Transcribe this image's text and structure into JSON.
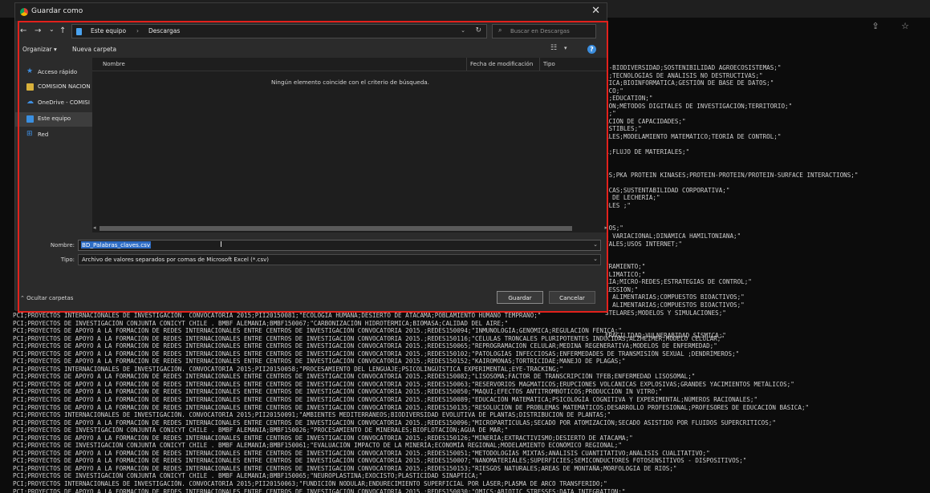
{
  "dialog": {
    "title": "Guardar como",
    "close_glyph": "✕",
    "nav": {
      "back": "←",
      "forward": "→",
      "recent": "⌄",
      "up": "↑",
      "breadcrumb": [
        "Este equipo",
        "Descargas"
      ],
      "separator": "›",
      "dropdown": "⌄",
      "refresh": "↻"
    },
    "search": {
      "placeholder": "Buscar en Descargas",
      "icon": "⌕"
    },
    "toolbar": {
      "organize": "Organizar ▾",
      "new_folder": "Nueva carpeta",
      "view_icon": "☷",
      "view_dropdown": "▾",
      "help": "?"
    },
    "sidebar": {
      "items": [
        {
          "label": "Acceso rápido",
          "icon": "star-icon"
        },
        {
          "label": "COMISION NACION",
          "icon": "folder-icon"
        },
        {
          "label": "OneDrive - COMISI",
          "icon": "cloud-icon"
        },
        {
          "label": "Este equipo",
          "icon": "computer-icon",
          "selected": true
        },
        {
          "label": "Red",
          "icon": "network-icon"
        }
      ]
    },
    "file_pane": {
      "columns": [
        "Nombre",
        "Fecha de modificación",
        "Tipo"
      ],
      "empty_message": "Ningún elemento coincide con el criterio de búsqueda.",
      "scroll_left": "◂",
      "scroll_right": "▸"
    },
    "form": {
      "name_label": "Nombre:",
      "name_value": "BD_Palabras_claves.csv",
      "type_label": "Tipo:",
      "type_value": "Archivo de valores separados por comas de Microsoft Excel (*.csv)",
      "field_dropdown": "⌄",
      "cursor": "I"
    },
    "hide_folders": "⌃  Ocultar carpetas",
    "save": "Guardar",
    "cancel": "Cancelar"
  },
  "terminal": {
    "top_icons": "⇪ ☆",
    "right_lines": [
      "E-BIODIVERSIDAD;SOSTENIBILIDAD AGROECOSISTEMAS;\"",
      "E;TECNOLOGÍAS DE ANÁLISIS NO DESTRUCTIVAS;\"",
      "TICA;BIOINFORMATICA;GESTIÓN DE BASE DE DATOS;\"",
      "ICO;\"",
      "S;EDUCATION;\"",
      "IÓN;MÉTODOS DIGITALES DE INVESTIGACIÓN;TERRITORIO;\"",
      "D;\"",
      "ACIÓN DE CAPACIDADES;\"",
      "USTIBLES;\"",
      "ALES;MODELAMIENTO MATEMÁTICO;TEORÍA DE CONTROL;\"",
      "",
      "A;FLUJO DE MATERIALES;\"",
      "",
      "",
      "OS;PKA PROTEIN KINASES;PROTEIN-PROTEIN/PROTEIN-SURFACE INTERACTIONS;\"",
      "",
      "ICAS;SUSTENTABILIDAD CORPORATIVA;\"",
      "S DE LECHERÍA;\"",
      "OLES ;\"",
      "",
      "",
      "COS;\"",
      "S VARIACIONAL;DINÁMICA HAMILTONIANA;\"",
      "TALES;USOS INTERNET;\"",
      "",
      "",
      "TRAMIENTO;\"",
      "CLIMATICO;\"",
      "RÍA;MICRO-REDES;ESTRATEGIAS DE CONTROL;\"",
      "RESSION;\"",
      "S ALIMENTARIAS;COMPUESTOS BIOACTIVOS;\"",
      "S ALIMENTARIAS;COMPUESTOS BIOACTIVOS;\"",
      "STELARES;MODELOS Y SIMULACIONES;\"",
      "",
      "",
      "FRAGILIDAD;VULNERABIDAD SÍSMICA;\""
    ],
    "bottom_lines": [
      "PCI;PROYECTOS INTERNACIONALES DE INVESTIGACIÓN. CONVOCATORIA 2015;PII20150081;\"ECOLOGÍA HUMANA;DESIERTO DE ATACAMA;POBLAMIENTO HUMANO TEMPRANO;\"",
      "PCI;PROYECTOS DE INVESTIGACIÓN CONJUNTA CONICYT CHILE . BMBF ALEMANIA;BMBF150067;\"CARBONIZACIÓN HIDROTÉRMICA;BIOMASA;CALIDAD DEL AIRE;\"",
      "PCI;PROYECTOS DE APOYO A LA FORMACIÓN DE REDES INTERNACIONALES ENTRE CENTROS DE INVESTIGACIÓN CONVOCATORIA 2015.;REDES150094;\"INMUNOLOGÍA;GENÓMICA;REGULACIÓN FÉNICA;\"",
      "PCI;PROYECTOS DE APOYO A LA FORMACIÓN DE REDES INTERNACIONALES ENTRE CENTROS DE INVESTIGACIÓN CONVOCATORIA 2015.;REDES150116;\"CÉLULAS TRONCALES PLURIPOTENTES INDUCIDAS;ALZHEIMER;MODELO CELULAR;\"",
      "PCI;PROYECTOS DE APOYO A LA FORMACIÓN DE REDES INTERNACIONALES ENTRE CENTROS DE INVESTIGACIÓN CONVOCATORIA 2015.;REDES150065;\"REPROGRAMACION CELULAR;MEDINA REGENERATIVA;MODELOS DE ENFERMEDAD;\"",
      "PCI;PROYECTOS DE APOYO A LA FORMACIÓN DE REDES INTERNACIONALES ENTRE CENTROS DE INVESTIGACIÓN CONVOCATORIA 2015.;REDES150102;\"PATOLOGÍAS INFECCIOSAS;ENFERMEDADES DE TRANSMISIÓN SEXUAL ;DENDRÍMEROS;\"",
      "PCI;PROYECTOS DE APOYO A LA FORMACIÓN DE REDES INTERNACIONALES ENTRE CENTROS DE INVESTIGACIÓN CONVOCATORIA 2015.;REDES150152;\"KAIROMONAS;TORTRICIDAE;MANEJO DE PLAGAS;\"",
      "PCI;PROYECTOS INTERNACIONALES DE INVESTIGACIÓN. CONVOCATORIA 2015;PII20150058;\"PROCESAMIENTO DEL LENGUAJE;PSICOLINGÜÍSTICA EXPERIMENTAL;EYE-TRACKING;\"",
      "PCI;PROYECTOS DE APOYO A LA FORMACIÓN DE REDES INTERNACIONALES ENTRE CENTROS DE INVESTIGACIÓN CONVOCATORIA 2015.;REDES150082;\"LISOSOMA;FACTOR DE TRANSCRIPCIÓN TFEB;ENFERMEDAD LISOSOMAL;\"",
      "PCI;PROYECTOS DE APOYO A LA FORMACIÓN DE REDES INTERNACIONALES ENTRE CENTROS DE INVESTIGACIÓN CONVOCATORIA 2015.;REDES150063;\"RESERVORIOS MAGMATICOS;ERUPCIONES VOLCÁNICAS EXPLOSIVAS;GRANDES YACIMIENTOS METÁLICOS;\"",
      "PCI;PROYECTOS DE APOYO A LA FORMACIÓN DE REDES INTERNACIONALES ENTRE CENTROS DE INVESTIGACIÓN CONVOCATORIA 2015.;REDES150050;\"MAQUI;EFECTOS ANTITROMBÓTICOS;PRODUCCIÓN IN VITRO;\"",
      "PCI;PROYECTOS DE APOYO A LA FORMACIÓN DE REDES INTERNACIONALES ENTRE CENTROS DE INVESTIGACIÓN CONVOCATORIA 2015.;REDES150089;\"EDUCACIÓN MATEMÁTICA;PSICOLOGÍA COGNITIVA Y EXPERIMENTAL;NÚMEROS RACIONALES;\"",
      "PCI;PROYECTOS DE APOYO A LA FORMACIÓN DE REDES INTERNACIONALES ENTRE CENTROS DE INVESTIGACIÓN CONVOCATORIA 2015.;REDES150135;\"RESOLUCIÓN DE PROBLEMAS MATEMÁTICOS;DESARROLLO PROFESIONAL;PROFESORES DE EDUCACIÓN BÁSICA;\"",
      "PCI;PROYECTOS INTERNACIONALES DE INVESTIGACIÓN. CONVOCATORIA 2015;PII20150091;\"AMBIENTES MEDITERRÁNEOS;BIODIVERSIDAD EVOLUTIVA DE PLANTAS;DISTRIBUCION DE PLANTAS;\"",
      "PCI;PROYECTOS DE APOYO A LA FORMACIÓN DE REDES INTERNACIONALES ENTRE CENTROS DE INVESTIGACIÓN CONVOCATORIA 2015.;REDES150096;\"MICROPARTICULAS;SECADO POR ATOMIZACIÓN;SECADO ASISTIDO POR FLUIDOS SUPERCRITICOS;\"",
      "PCI;PROYECTOS DE INVESTIGACIÓN CONJUNTA CONICYT CHILE . BMBF ALEMANIA;BMBF150026;\"PROCESAMIENTO DE MINERALES;BIOFLOTACIÓN;AGUA DE MAR;\"",
      "PCI;PROYECTOS DE APOYO A LA FORMACIÓN DE REDES INTERNACIONALES ENTRE CENTROS DE INVESTIGACIÓN CONVOCATORIA 2015.;REDES150126;\"MINERÍA;EXTRACTIVISMO;DESIERTO DE ATACAMA;\"",
      "PCI;PROYECTOS DE INVESTIGACIÓN CONJUNTA CONICYT CHILE . BMBF ALEMANIA;BMBF150061;\"EVALUACIÓN IMPACTO DE LA MINERÍA;ECONOMÍA REGIONAL;MODELAMIENTO ECONÓMICO REGIONAL;\"",
      "PCI;PROYECTOS DE APOYO A LA FORMACIÓN DE REDES INTERNACIONALES ENTRE CENTROS DE INVESTIGACIÓN CONVOCATORIA 2015.;REDES150051;\"METODOLOGÍAS MIXTAS;ANÁLISIS CUANTITATIVO;ANÁLISIS CUALITATIVO;\"",
      "PCI;PROYECTOS DE APOYO A LA FORMACIÓN DE REDES INTERNACIONALES ENTRE CENTROS DE INVESTIGACIÓN CONVOCATORIA 2015.;REDES150007;\"NANOMATERIALES;SUPERFICIES;SEMICONDUCTORES FOTOSENSITIVOS - DISPOSITIVOS;\"",
      "PCI;PROYECTOS DE APOYO A LA FORMACIÓN DE REDES INTERNACIONALES ENTRE CENTROS DE INVESTIGACIÓN CONVOCATORIA 2015.;REDES150153;\"RIESGOS NATURALES;AREAS DE MONTAÑA;MORFOLOGIA DE RIOS;\"",
      "PCI;PROYECTOS DE INVESTIGACIÓN CONJUNTA CONICYT CHILE . BMBF ALEMANIA;BMBF150065;\"NEUROPLASTINA;EXOCISTO;PLASTICIDAD SINAPTICA;\"",
      "PCI;PROYECTOS INTERNACIONALES DE INVESTIGACIÓN. CONVOCATORIA 2015;PII20150063;\"FUNDICIÓN NODULAR;ENDURECIMIENTO SUPERFICIAL POR LÁSER;PLASMA DE ARCO TRANSFERIDO;\"",
      "PCI;PROYECTOS DE APOYO A LA FORMACIÓN DE REDES INTERNACIONALES ENTRE CENTROS DE INVESTIGACIÓN CONVOCATORIA 2015.;REDES150030;\"OMICS;ABIOTIC STRESSES;DATA INTEGRATION;\""
    ]
  }
}
